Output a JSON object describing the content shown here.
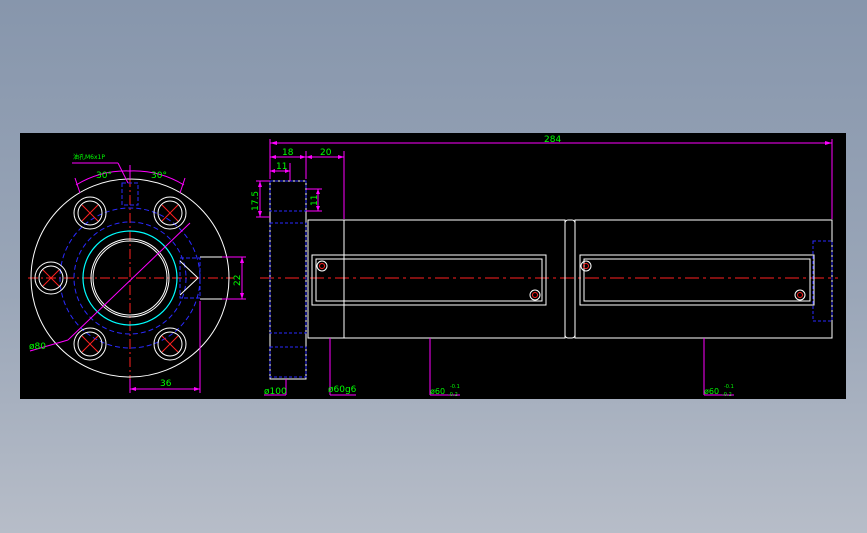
{
  "colors": {
    "background": "#000000",
    "outline": "#ffffff",
    "centerline": "#ff2020",
    "hidden": "#2a2aff",
    "dimension": "#ff00ff",
    "dim_text": "#00ff00",
    "highlight": "#00ffff",
    "hatch": "#1a1aff"
  },
  "front_view": {
    "note": "油孔M6x1P",
    "angle_left": "30°",
    "angle_right": "30°",
    "dim_22": "22",
    "dim_36": "36",
    "dim_d80": "ø80"
  },
  "side_view": {
    "dim_284": "284",
    "dim_18": "18",
    "dim_20": "20",
    "dim_11_top": "11",
    "dim_11_side": "11",
    "dim_17_5": "17.5",
    "dim_d100": "ø100",
    "dim_d60g6": "ø60g6",
    "dim_d60_a": "ø60",
    "dim_d60_b": "ø60",
    "tol_upper": "-0.1",
    "tol_lower": "-0.2"
  }
}
